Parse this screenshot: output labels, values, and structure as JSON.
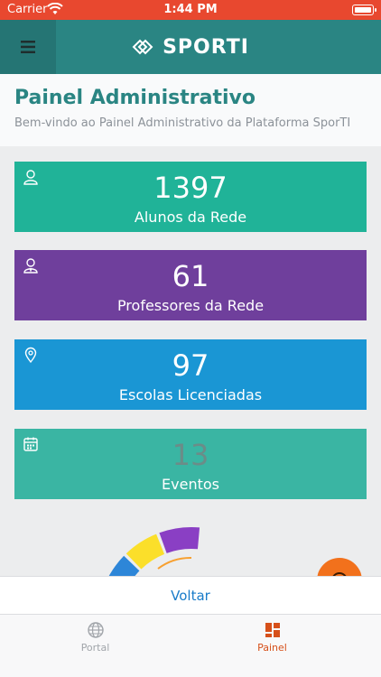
{
  "status_bar": {
    "carrier": "Carrier",
    "time": "1:44 PM"
  },
  "nav": {
    "brand": "SPORTI"
  },
  "header": {
    "title": "Painel Administrativo",
    "subtitle": "Bem-vindo ao Painel Administrativo da Plataforma SporTI"
  },
  "cards": [
    {
      "value": "1397",
      "label": "Alunos da Rede",
      "icon": "user-icon",
      "color": "#20b398"
    },
    {
      "value": "61",
      "label": "Professores da Rede",
      "icon": "teacher-icon",
      "color": "#6f3f9c"
    },
    {
      "value": "97",
      "label": "Escolas Licenciadas",
      "icon": "location-pin-icon",
      "color": "#1a96d4"
    },
    {
      "value": "13",
      "label": "Eventos",
      "icon": "calendar-icon",
      "color": "#3ab5a3"
    }
  ],
  "gauge": {
    "segment_colors": [
      "#e8483a",
      "#f7a030",
      "#2d86d8",
      "#fbdf2a",
      "#8a3fc4"
    ]
  },
  "back_button": "Voltar",
  "tabs": [
    {
      "label": "Portal",
      "icon": "globe-icon",
      "active": false
    },
    {
      "label": "Painel",
      "icon": "dashboard-icon",
      "active": true
    }
  ],
  "colors": {
    "status_bar": "#e8482f",
    "nav": "#2a8583",
    "accent": "#d6501a",
    "link": "#1a7cc9"
  }
}
